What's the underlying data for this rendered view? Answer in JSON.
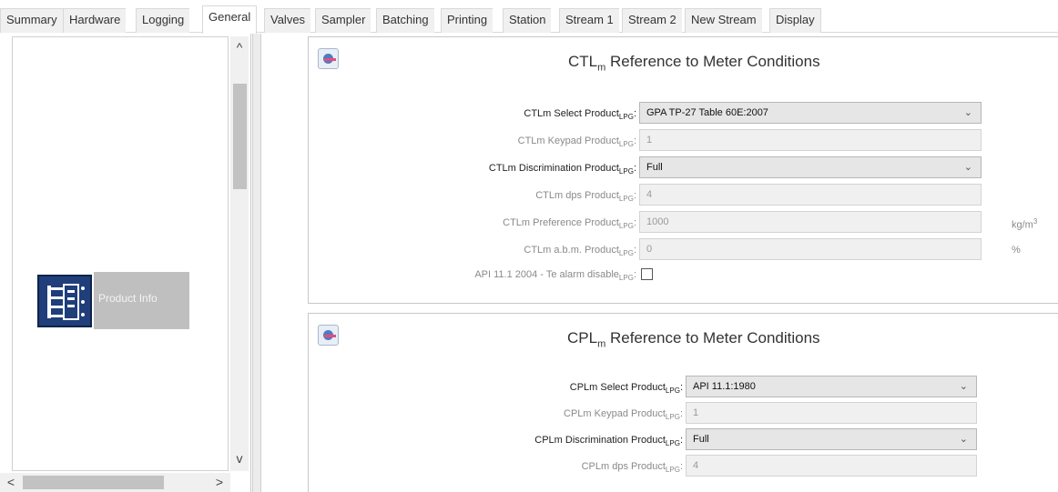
{
  "tabs": [
    {
      "label": "Summary"
    },
    {
      "label": "Hardware"
    },
    {
      "label": "Logging"
    },
    {
      "label": "General"
    },
    {
      "label": "Valves"
    },
    {
      "label": "Sampler"
    },
    {
      "label": "Batching"
    },
    {
      "label": "Printing"
    },
    {
      "label": "Station"
    },
    {
      "label": "Stream 1"
    },
    {
      "label": "Stream 2"
    },
    {
      "label": "New Stream"
    },
    {
      "label": "Display"
    }
  ],
  "active_tab": "General",
  "left": {
    "item_label": "Product Info",
    "scroll_up": "^",
    "scroll_down": "v",
    "scroll_left": "<",
    "scroll_right": ">"
  },
  "ctl": {
    "title_prefix": "CTL",
    "title_sub": "m",
    "title_rest": " Reference to Meter Conditions",
    "rows": [
      {
        "label": "CTLm Select Product",
        "suffix": "LPG",
        "value": "GPA TP-27 Table 60E:2007",
        "type": "select"
      },
      {
        "label": "CTLm Keypad Product",
        "suffix": "LPG",
        "value": "1",
        "type": "text"
      },
      {
        "label": "CTLm Discrimination Product",
        "suffix": "LPG",
        "value": "Full",
        "type": "select"
      },
      {
        "label": "CTLm dps Product",
        "suffix": "LPG",
        "value": "4",
        "type": "text"
      },
      {
        "label": "CTLm Preference Product",
        "suffix": "LPG",
        "value": "1000",
        "type": "text",
        "unit": "kg/m",
        "unit_sup": "3"
      },
      {
        "label": "CTLm a.b.m. Product",
        "suffix": "LPG",
        "value": "0",
        "type": "text",
        "unit": "%"
      },
      {
        "label": "API 11.1 2004 - Te alarm disable",
        "suffix": "LPG",
        "type": "checkbox",
        "checked": false
      }
    ]
  },
  "cpl": {
    "title_prefix": "CPL",
    "title_sub": "m",
    "title_rest": " Reference to Meter Conditions",
    "rows": [
      {
        "label": "CPLm Select Product",
        "suffix": "LPG",
        "value": "API 11.1:1980",
        "type": "select"
      },
      {
        "label": "CPLm Keypad Product",
        "suffix": "LPG",
        "value": "1",
        "type": "text"
      },
      {
        "label": "CPLm Discrimination Product",
        "suffix": "LPG",
        "value": "Full",
        "type": "select"
      },
      {
        "label": "CPLm dps Product",
        "suffix": "LPG",
        "value": "4",
        "type": "text"
      }
    ]
  },
  "colors": {
    "active_tab_bg": "#ffffff",
    "tab_bg": "#f0f0f0",
    "left_item_bg": "#bfbfbf",
    "icon_bg": "#1f3e7a"
  }
}
